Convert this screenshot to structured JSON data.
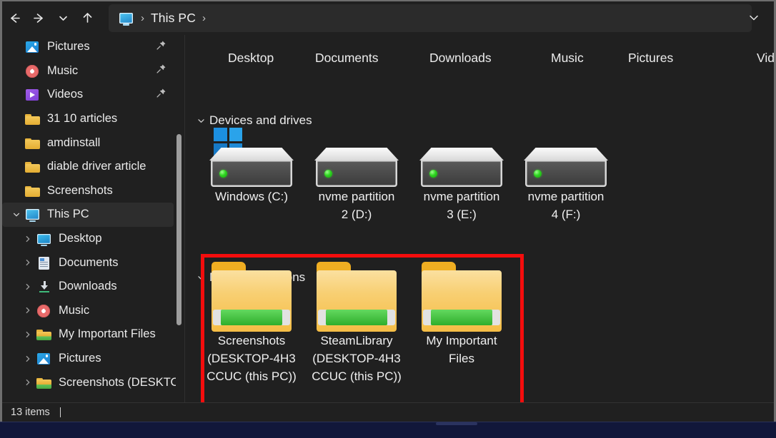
{
  "window": {
    "title": "This PC",
    "accent_color": "#202020",
    "annotation_color": "#f40d0d"
  },
  "toolbar": {
    "back_icon": "back-arrow-icon",
    "forward_icon": "forward-arrow-icon",
    "recent_icon": "chevron-down-icon",
    "up_icon": "up-arrow-icon",
    "expand_icon": "chevron-down-icon"
  },
  "address_bar": {
    "icon": "this-pc-icon",
    "leading_separator": "›",
    "crumb": "This PC",
    "trailing_separator": "›"
  },
  "sidebar": {
    "items": [
      {
        "label": "Pictures",
        "icon": "pictures-icon",
        "pinned": true,
        "expandable": false,
        "indent": 0,
        "selected": false
      },
      {
        "label": "Music",
        "icon": "music-icon",
        "pinned": true,
        "expandable": false,
        "indent": 0,
        "selected": false
      },
      {
        "label": "Videos",
        "icon": "videos-icon",
        "pinned": true,
        "expandable": false,
        "indent": 0,
        "selected": false
      },
      {
        "label": "31 10 articles",
        "icon": "folder-icon",
        "pinned": false,
        "expandable": false,
        "indent": 0,
        "selected": false
      },
      {
        "label": "amdinstall",
        "icon": "folder-icon",
        "pinned": false,
        "expandable": false,
        "indent": 0,
        "selected": false
      },
      {
        "label": "diable driver article",
        "icon": "folder-icon",
        "pinned": false,
        "expandable": false,
        "indent": 0,
        "selected": false
      },
      {
        "label": "Screenshots",
        "icon": "folder-icon",
        "pinned": false,
        "expandable": false,
        "indent": 0,
        "selected": false
      },
      {
        "label": "This PC",
        "icon": "this-pc-icon",
        "pinned": false,
        "expandable": true,
        "expanded": true,
        "indent": 0,
        "selected": true
      },
      {
        "label": "Desktop",
        "icon": "desktop-icon",
        "pinned": false,
        "expandable": true,
        "expanded": false,
        "indent": 1,
        "selected": false
      },
      {
        "label": "Documents",
        "icon": "documents-icon",
        "pinned": false,
        "expandable": true,
        "expanded": false,
        "indent": 1,
        "selected": false
      },
      {
        "label": "Downloads",
        "icon": "downloads-icon",
        "pinned": false,
        "expandable": true,
        "expanded": false,
        "indent": 1,
        "selected": false
      },
      {
        "label": "Music",
        "icon": "music-icon",
        "pinned": false,
        "expandable": true,
        "expanded": false,
        "indent": 1,
        "selected": false
      },
      {
        "label": "My Important Files",
        "icon": "network-folder-icon",
        "pinned": false,
        "expandable": true,
        "expanded": false,
        "indent": 1,
        "selected": false
      },
      {
        "label": "Pictures",
        "icon": "pictures-icon",
        "pinned": false,
        "expandable": true,
        "expanded": false,
        "indent": 1,
        "selected": false
      },
      {
        "label": "Screenshots (DESKTOP-",
        "icon": "network-folder-icon",
        "pinned": false,
        "expandable": true,
        "expanded": false,
        "indent": 1,
        "selected": false
      }
    ]
  },
  "quick_access_row": [
    {
      "label": "Desktop"
    },
    {
      "label": "Documents"
    },
    {
      "label": "Downloads"
    },
    {
      "label": "Music"
    },
    {
      "label": "Pictures"
    },
    {
      "label": "Vid"
    }
  ],
  "groups": [
    {
      "name": "devices_and_drives",
      "label": "Devices and drives",
      "expanded": true
    },
    {
      "name": "network_locations",
      "label": "Network locations",
      "expanded": true
    }
  ],
  "drives": [
    {
      "label": "Windows (C:)",
      "icon": "drive-icon",
      "has_windows_logo": true,
      "led": "#2fd321"
    },
    {
      "label": "nvme partition\n2 (D:)",
      "icon": "drive-icon",
      "has_windows_logo": false,
      "led": "#2fd321"
    },
    {
      "label": "nvme partition\n3 (E:)",
      "icon": "drive-icon",
      "has_windows_logo": false,
      "led": "#2fd321"
    },
    {
      "label": "nvme partition\n4 (F:)",
      "icon": "drive-icon",
      "has_windows_logo": false,
      "led": "#2fd321"
    }
  ],
  "network_locations": [
    {
      "label": "Screenshots\n(DESKTOP-4H3\nCCUC (this PC))",
      "icon": "network-folder-icon"
    },
    {
      "label": "SteamLibrary\n(DESKTOP-4H3\nCCUC (this PC))",
      "icon": "network-folder-icon"
    },
    {
      "label": "My Important\nFiles",
      "icon": "network-folder-icon"
    }
  ],
  "status_bar": {
    "item_count": "13 items"
  }
}
